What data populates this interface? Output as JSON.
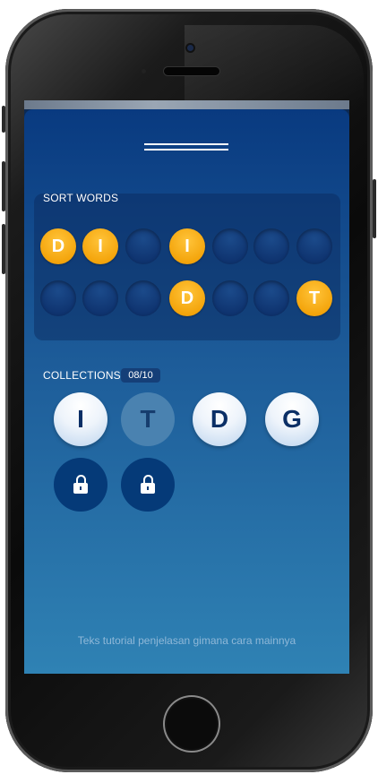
{
  "sort_words": {
    "label": "SORT WORDS",
    "rows": [
      [
        "D",
        "I",
        "",
        "I",
        "",
        "",
        ""
      ],
      [
        "",
        "",
        "",
        "D",
        "",
        "",
        "T"
      ]
    ]
  },
  "collections": {
    "label": "COLLECTIONS",
    "count": "08/10",
    "items": [
      {
        "letter": "I",
        "state": "unlocked"
      },
      {
        "letter": "T",
        "state": "dimmed"
      },
      {
        "letter": "D",
        "state": "unlocked"
      },
      {
        "letter": "G",
        "state": "unlocked"
      },
      {
        "letter": "",
        "state": "locked",
        "icon": "lock-icon"
      },
      {
        "letter": "",
        "state": "locked",
        "icon": "lock-icon"
      }
    ]
  },
  "tutorial_text": "Teks tutorial penjelasan gimana cara mainnya",
  "colors": {
    "tile_orange": "#f4a50c",
    "background_top": "#093a80",
    "background_bottom": "#2f82b4",
    "locked_circle": "#053a78"
  }
}
